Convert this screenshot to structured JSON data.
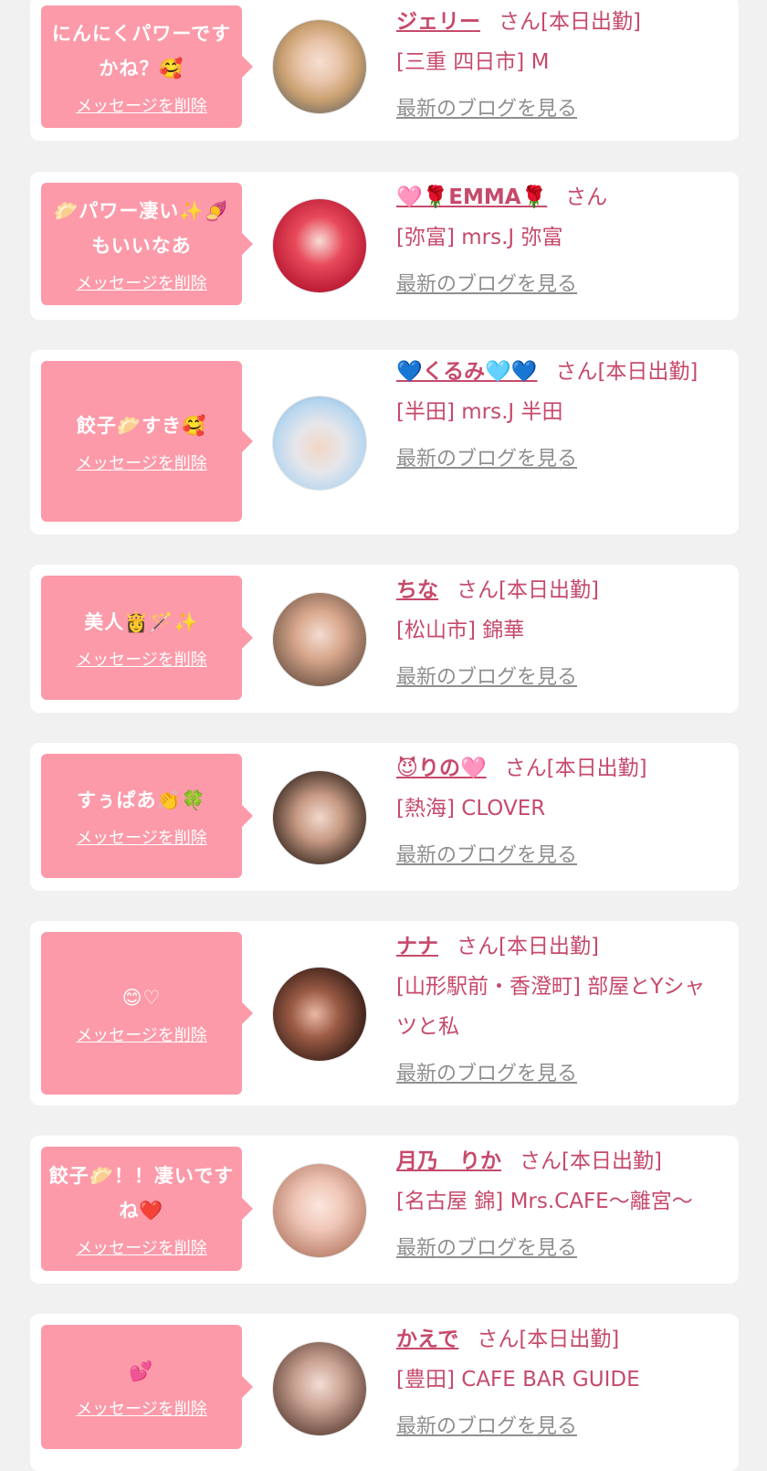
{
  "common": {
    "delete_label": "メッセージを削除",
    "blog_label": "最新のブログを見る"
  },
  "colors": {
    "background": "#f1f1f1",
    "bubble": "#fc9aa9",
    "accent_text": "#c64a6b",
    "blog_link": "#8f8f8f"
  },
  "cards": [
    {
      "message": "にんにくパワーですかね？🥰",
      "name": "ジェリー",
      "suffix": "さん[本日出勤]",
      "location": "[三重 四日市] M"
    },
    {
      "message": "🥟パワー凄い✨🍠もいいなあ",
      "name": "🩷🌹EMMA🌹",
      "suffix": "さん",
      "location": "[弥富] mrs.J 弥富"
    },
    {
      "message": "餃子🥟すき🥰",
      "name": "💙くるみ🩵💙",
      "suffix": "さん[本日出勤]",
      "location": "[半田] mrs.J 半田"
    },
    {
      "message": "美人👸🪄✨",
      "name": "ちな",
      "suffix": "さん[本日出勤]",
      "location": "[松山市] 錦華"
    },
    {
      "message": "すぅぱあ👏🍀",
      "name": "😈りの🩷",
      "suffix": "さん[本日出勤]",
      "location": "[熱海] CLOVER"
    },
    {
      "message": "😊♡",
      "name": "ナナ",
      "suffix": "さん[本日出勤]",
      "location": "[山形駅前・香澄町] 部屋とYシャツと私"
    },
    {
      "message": "餃子🥟！！凄いですね❤️",
      "name": "月乃　りか",
      "suffix": "さん[本日出勤]",
      "location": "[名古屋 錦] Mrs.CAFE〜離宮〜"
    },
    {
      "message": "💕",
      "name": "かえで",
      "suffix": "さん[本日出勤]",
      "location": "[豊田] CAFE BAR GUIDE"
    }
  ]
}
